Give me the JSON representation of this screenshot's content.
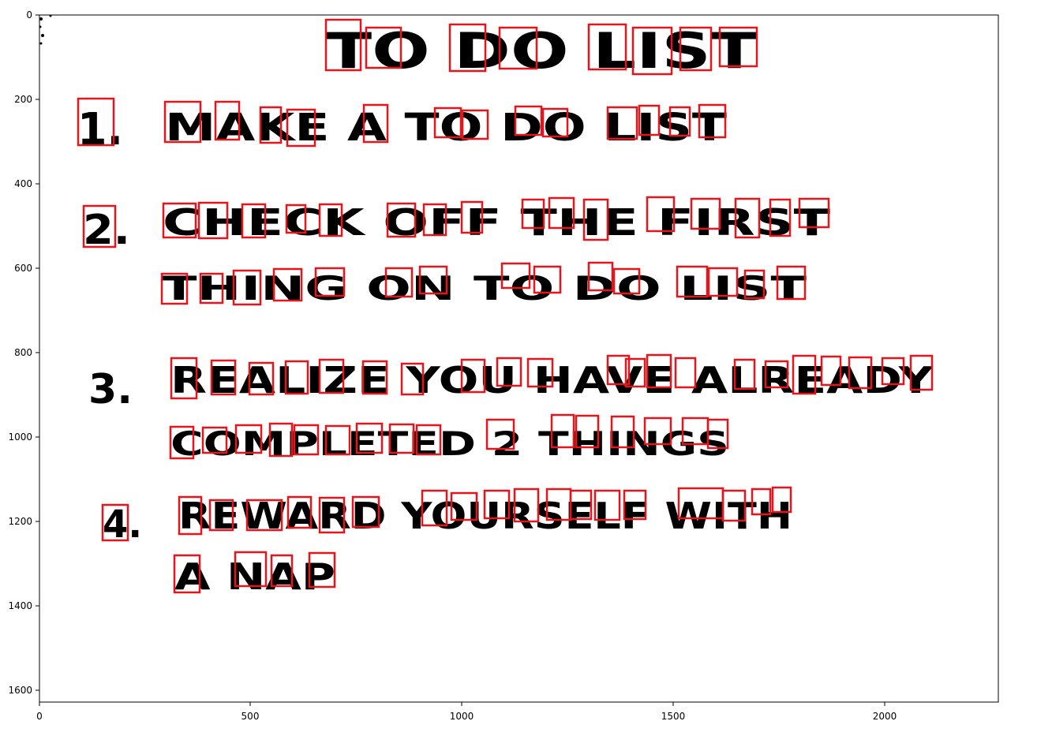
{
  "plot": {
    "x_ticks": [
      "0",
      "500",
      "1000",
      "1500",
      "2000"
    ],
    "y_ticks": [
      "0",
      "200",
      "400",
      "600",
      "800",
      "1000",
      "1200",
      "1400",
      "1600"
    ]
  },
  "note": {
    "title": "TO DO LIST",
    "items": [
      {
        "number": "1.",
        "lines": [
          "MAKE A TO DO LIST"
        ]
      },
      {
        "number": "2.",
        "lines": [
          "CHECK OFF THE FIRST",
          "THING ON TO DO LIST"
        ]
      },
      {
        "number": "3.",
        "lines": [
          "REALIZE YOU HAVE ALREADY",
          "COMPLETED 2 THINGS"
        ]
      },
      {
        "number": "4.",
        "lines": [
          "REWARD YOURSELF WITH",
          "A NAP"
        ]
      }
    ]
  },
  "colors": {
    "box_stroke": "#e8141c",
    "ink": "#000000",
    "axes": "#000000",
    "background": "#ffffff"
  }
}
